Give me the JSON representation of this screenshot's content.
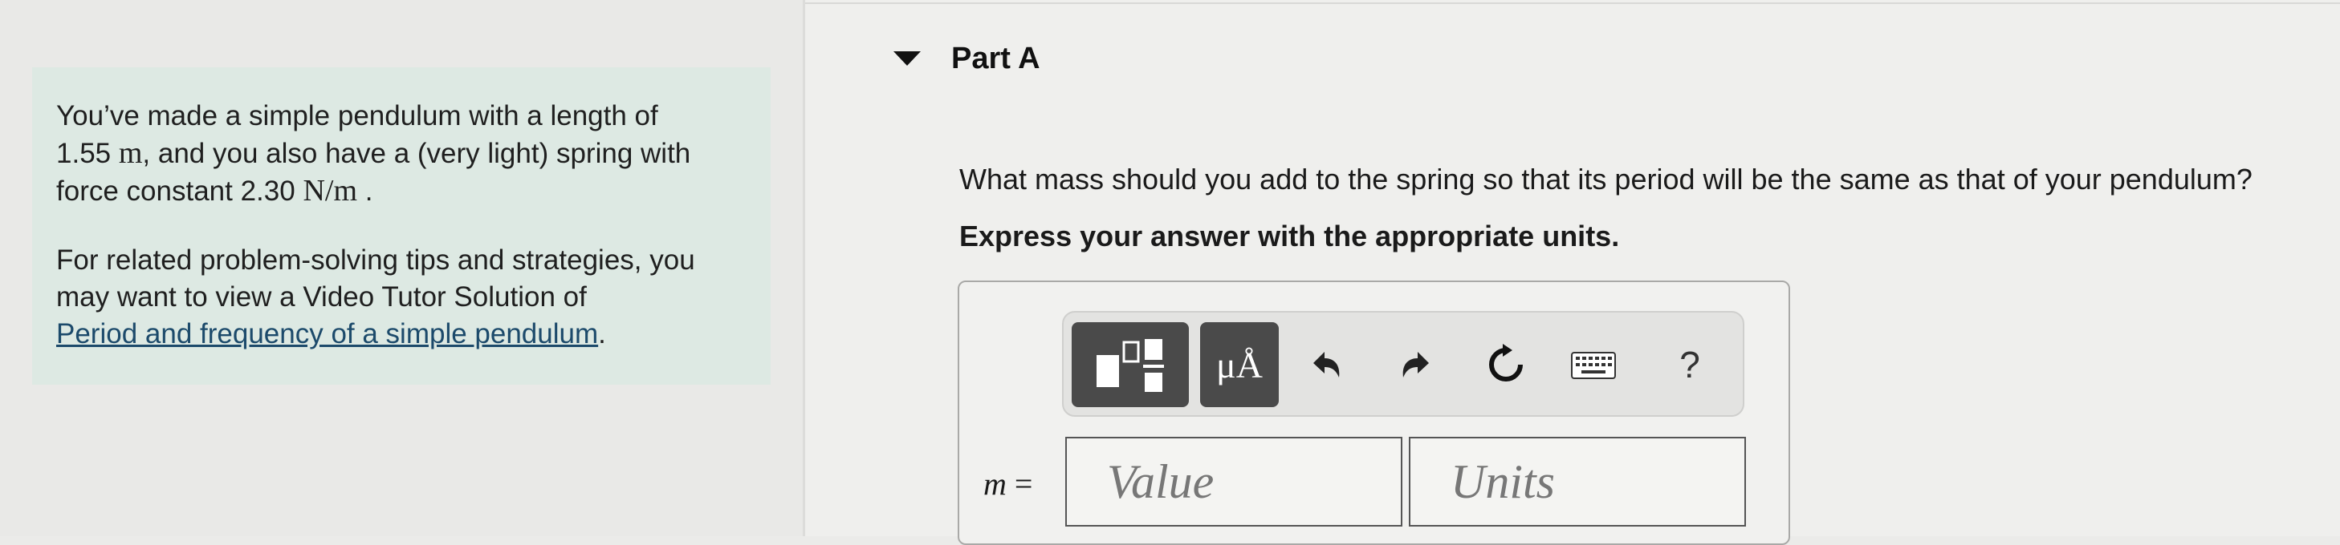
{
  "problem": {
    "line1": "You’ve made a simple pendulum with a length of",
    "length_value": "1.55",
    "length_unit": "m",
    "line2_rest": ", and you also have a (very light) spring with",
    "line3_prefix": "force constant",
    "k_value": "2.30",
    "k_unit": "N/m",
    "line3_suffix": ".",
    "tips_text": "For related problem-solving tips and strategies, you may want to view a Video Tutor Solution of",
    "tips_link": "Period and frequency of a simple pendulum",
    "tips_end": "."
  },
  "part": {
    "title": "Part A",
    "question": "What mass should you add to the spring so that its period will be the same as that of your pendulum?",
    "instructions": "Express your answer with the appropriate units."
  },
  "toolbar": {
    "templates_icon": "templates-icon",
    "units_label": "μÅ",
    "undo_icon": "undo-icon",
    "redo_icon": "redo-icon",
    "reset_icon": "reset-icon",
    "keyboard_icon": "keyboard-icon",
    "help_label": "?"
  },
  "answer": {
    "variable": "m",
    "equals": "=",
    "value_placeholder": "Value",
    "units_placeholder": "Units",
    "value": "",
    "units": ""
  },
  "colors": {
    "info_box_bg": "#dde9e3",
    "link": "#1c4a6b",
    "toolbar_dark": "#4a4a4a"
  }
}
